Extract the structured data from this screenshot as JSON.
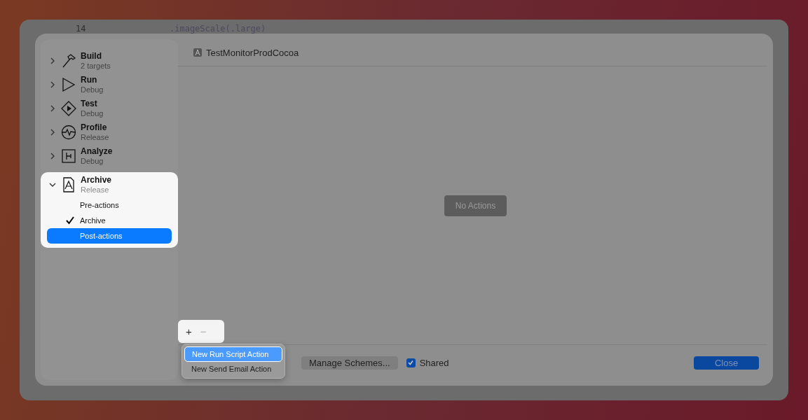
{
  "editor": {
    "line_number": "14",
    "code": ".imageScale(.large)"
  },
  "sidebar": {
    "actions": [
      {
        "kind": "build",
        "name": "Build",
        "detail": "2 targets",
        "expanded": false,
        "highlighted": false
      },
      {
        "kind": "run",
        "name": "Run",
        "detail": "Debug",
        "expanded": false,
        "highlighted": false
      },
      {
        "kind": "test",
        "name": "Test",
        "detail": "Debug",
        "expanded": false,
        "highlighted": false
      },
      {
        "kind": "profile",
        "name": "Profile",
        "detail": "Release",
        "expanded": false,
        "highlighted": false
      },
      {
        "kind": "analyze",
        "name": "Analyze",
        "detail": "Debug",
        "expanded": false,
        "highlighted": false
      },
      {
        "kind": "archive",
        "name": "Archive",
        "detail": "Release",
        "expanded": true,
        "highlighted": true,
        "children": [
          {
            "label": "Pre-actions",
            "checked": false,
            "selected": false
          },
          {
            "label": "Archive",
            "checked": true,
            "selected": false
          },
          {
            "label": "Post-actions",
            "checked": false,
            "selected": true
          }
        ]
      }
    ]
  },
  "header": {
    "title": "TestMonitorProdCocoa"
  },
  "content": {
    "placeholder_label": "No Actions"
  },
  "add_remove": {
    "add": "+",
    "remove": "−"
  },
  "add_menu": {
    "items": [
      {
        "label": "New Run Script Action",
        "selected": true
      },
      {
        "label": "New Send Email Action",
        "selected": false
      }
    ]
  },
  "footer": {
    "manage_button": "Manage Schemes...",
    "shared": {
      "label": "Shared",
      "checked": true
    },
    "close_button": "Close"
  }
}
